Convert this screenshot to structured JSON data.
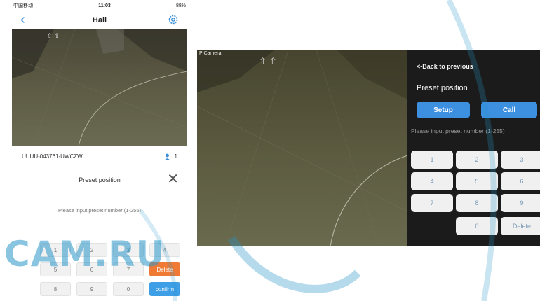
{
  "phone": {
    "status_bar": {
      "carrier": "中国移动",
      "time": "11:03",
      "battery": "88%"
    },
    "nav": {
      "title": "Hall"
    },
    "device_row": {
      "device_id": "UUUU-043761-UWCZW",
      "viewer_count": "1"
    },
    "preset": {
      "title": "Preset position",
      "placeholder": "Please input preset number (1-255)",
      "keys": [
        "1",
        "2",
        "3",
        "4",
        "5",
        "6",
        "7",
        "8",
        "9",
        "0"
      ],
      "delete_label": "Delete",
      "confirm_label": "confirm"
    }
  },
  "landscape": {
    "camera_label": "P Camera",
    "back_label": "<-Back to previous",
    "title": "Preset position",
    "setup_label": "Setup",
    "call_label": "Call",
    "hint": "Please input preset number (1-255)",
    "keys": [
      "1",
      "2",
      "3",
      "4",
      "5",
      "6",
      "7",
      "8",
      "9",
      "0"
    ],
    "delete_label": "Delete"
  },
  "watermark": {
    "text": "CAM.RU"
  },
  "colors": {
    "accent_blue": "#3d8fe0",
    "delete_orange": "#f07a35",
    "panel_dark": "#1b1b1b",
    "floor": "#5b5a3f"
  }
}
